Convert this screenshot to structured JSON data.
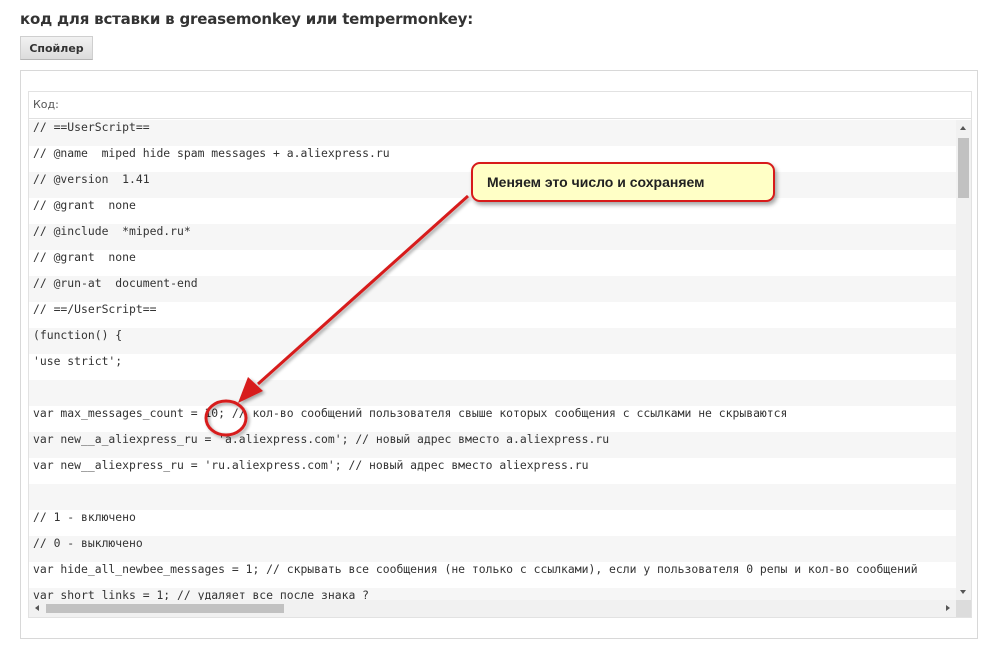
{
  "page": {
    "heading": "код для вставки в greasemonkey или tempermonkey:",
    "spoiler_button": "Спойлер"
  },
  "code_block": {
    "header_label": "Код:",
    "lines": [
      "// ==UserScript==",
      "// @name  miped hide spam messages + a.aliexpress.ru",
      "// @version  1.41",
      "// @grant  none",
      "// @include  *miped.ru*",
      "// @grant  none",
      "// @run-at  document-end",
      "// ==/UserScript==",
      "(function() {",
      "'use strict';",
      "",
      "var max_messages_count = 10; // кол-во сообщений пользователя свыше которых сообщения с ссылками не скрываются",
      "var new__a_aliexpress_ru = 'a.aliexpress.com'; // новый адрес вместо a.aliexpress.ru",
      "var new__aliexpress_ru = 'ru.aliexpress.com'; // новый адрес вместо aliexpress.ru",
      "",
      "// 1 - включено",
      "// 0 - выключено",
      "var hide_all_newbee_messages = 1; // скрывать все сообщения (не только с ссылками), если у пользователя 0 репы и кол-во сообщений",
      "var short_links = 1; // удаляет все после знака ?"
    ]
  },
  "annotation": {
    "callout_text": "Меняем это число и сохраняем",
    "color": "#d71a1a"
  }
}
